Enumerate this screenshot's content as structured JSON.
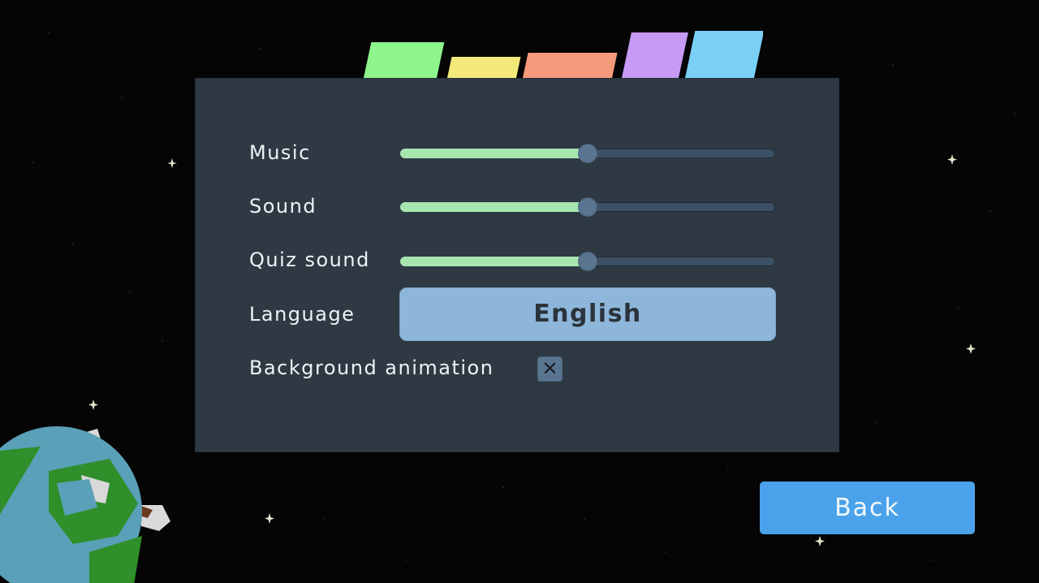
{
  "settings": {
    "music": {
      "label": "Music",
      "value": 0.5
    },
    "sound": {
      "label": "Sound",
      "value": 0.5
    },
    "quiz_sound": {
      "label": "Quiz sound",
      "value": 0.5
    },
    "language": {
      "label": "Language",
      "value": "English"
    },
    "background_animation": {
      "label": "Background animation",
      "checked": true,
      "mark": "✕"
    }
  },
  "back_button": {
    "label": "Back"
  },
  "colors": {
    "panel": "#2e3943",
    "slider_fill": "#a8e6b0",
    "slider_track": "#3d5166",
    "language_button": "#8db6da",
    "back_button": "#4aa3ea"
  }
}
